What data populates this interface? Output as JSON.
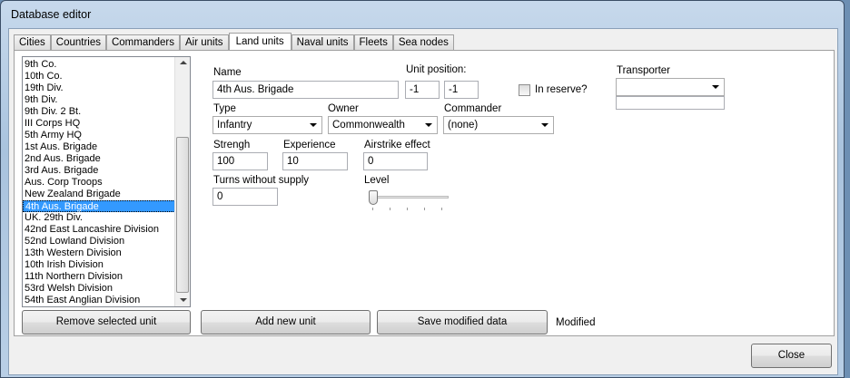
{
  "window": {
    "title": "Database editor"
  },
  "tabs": [
    "Cities",
    "Countries",
    "Commanders",
    "Air units",
    "Land units",
    "Naval units",
    "Fleets",
    "Sea nodes"
  ],
  "active_tab": "Land units",
  "units": [
    "9th Co.",
    "10th Co.",
    "19th Div.",
    "9th Div.",
    "9th Div. 2 Bt.",
    "III Corps HQ",
    "5th Army HQ",
    "1st Aus. Brigade",
    "2nd Aus. Brigade",
    "3rd Aus. Brigade",
    "Aus. Corp Troops",
    "New Zealand Brigade",
    "4th Aus. Brigade",
    "UK. 29th Div.",
    "42nd East Lancashire Division",
    "52nd Lowland Division",
    "13th Western Division",
    "10th Irish Division",
    "11th Northern Division",
    "53rd Welsh Division",
    "54th East Anglian Division"
  ],
  "selected_unit": "4th Aus. Brigade",
  "form": {
    "name_label": "Name",
    "name_value": "4th Aus. Brigade",
    "position_label": "Unit position:",
    "pos_x": "-1",
    "pos_y": "-1",
    "reserve_label": "In reserve?",
    "transporter_label": "Transporter",
    "transporter_value": "",
    "type_label": "Type",
    "type_value": "Infantry",
    "owner_label": "Owner",
    "owner_value": "Commonwealth",
    "commander_label": "Commander",
    "commander_value": "(none)",
    "strength_label": "Strengh",
    "strength_value": "100",
    "experience_label": "Experience",
    "experience_value": "10",
    "airstrike_label": "Airstrike effect",
    "airstrike_value": "0",
    "turns_label": "Turns without supply",
    "turns_value": "0",
    "level_label": "Level",
    "level_value": 0
  },
  "buttons": {
    "remove": "Remove selected unit",
    "add": "Add new unit",
    "save": "Save modified data",
    "close": "Close"
  },
  "status": "Modified"
}
